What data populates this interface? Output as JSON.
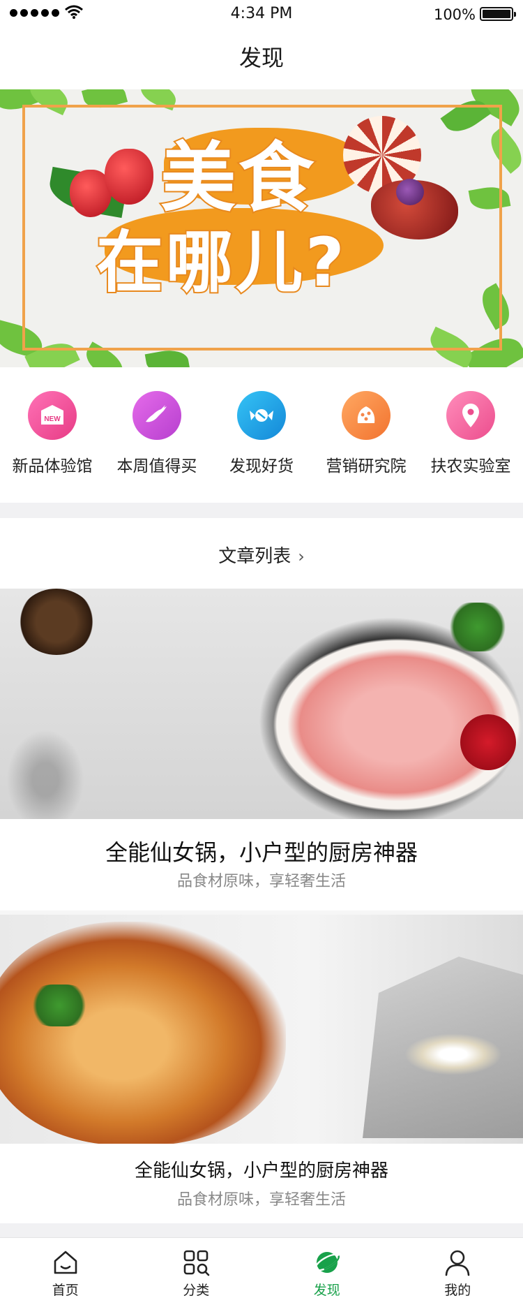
{
  "status_bar": {
    "time": "4:34 PM",
    "battery": "100%"
  },
  "header": {
    "title": "发现"
  },
  "banner": {
    "line1": "美食",
    "line2": "在哪儿?"
  },
  "categories": [
    {
      "label": "新品体验馆",
      "icon": "new-tag-icon",
      "color": "#f0559a"
    },
    {
      "label": "本周值得买",
      "icon": "bird-icon",
      "color": "#c94fd7"
    },
    {
      "label": "发现好货",
      "icon": "candy-icon",
      "color": "#1aa6e6"
    },
    {
      "label": "营销研究院",
      "icon": "pie-icon",
      "color": "#f5874a"
    },
    {
      "label": "扶农实验室",
      "icon": "location-pin-icon",
      "color": "#f0619a"
    }
  ],
  "article_section": {
    "title": "文章列表"
  },
  "articles": [
    {
      "title": "全能仙女锅，小户型的厨房神器",
      "subtitle": "品食材原味，享轻奢生活"
    },
    {
      "title": "全能仙女锅，小户型的厨房神器",
      "subtitle": "品食材原味，享轻奢生活"
    }
  ],
  "tabbar": {
    "items": [
      {
        "label": "首页",
        "icon": "home-icon"
      },
      {
        "label": "分类",
        "icon": "grid-search-icon"
      },
      {
        "label": "发现",
        "icon": "planet-icon",
        "active": true
      },
      {
        "label": "我的",
        "icon": "user-icon"
      }
    ],
    "active_color": "#18a14a"
  }
}
